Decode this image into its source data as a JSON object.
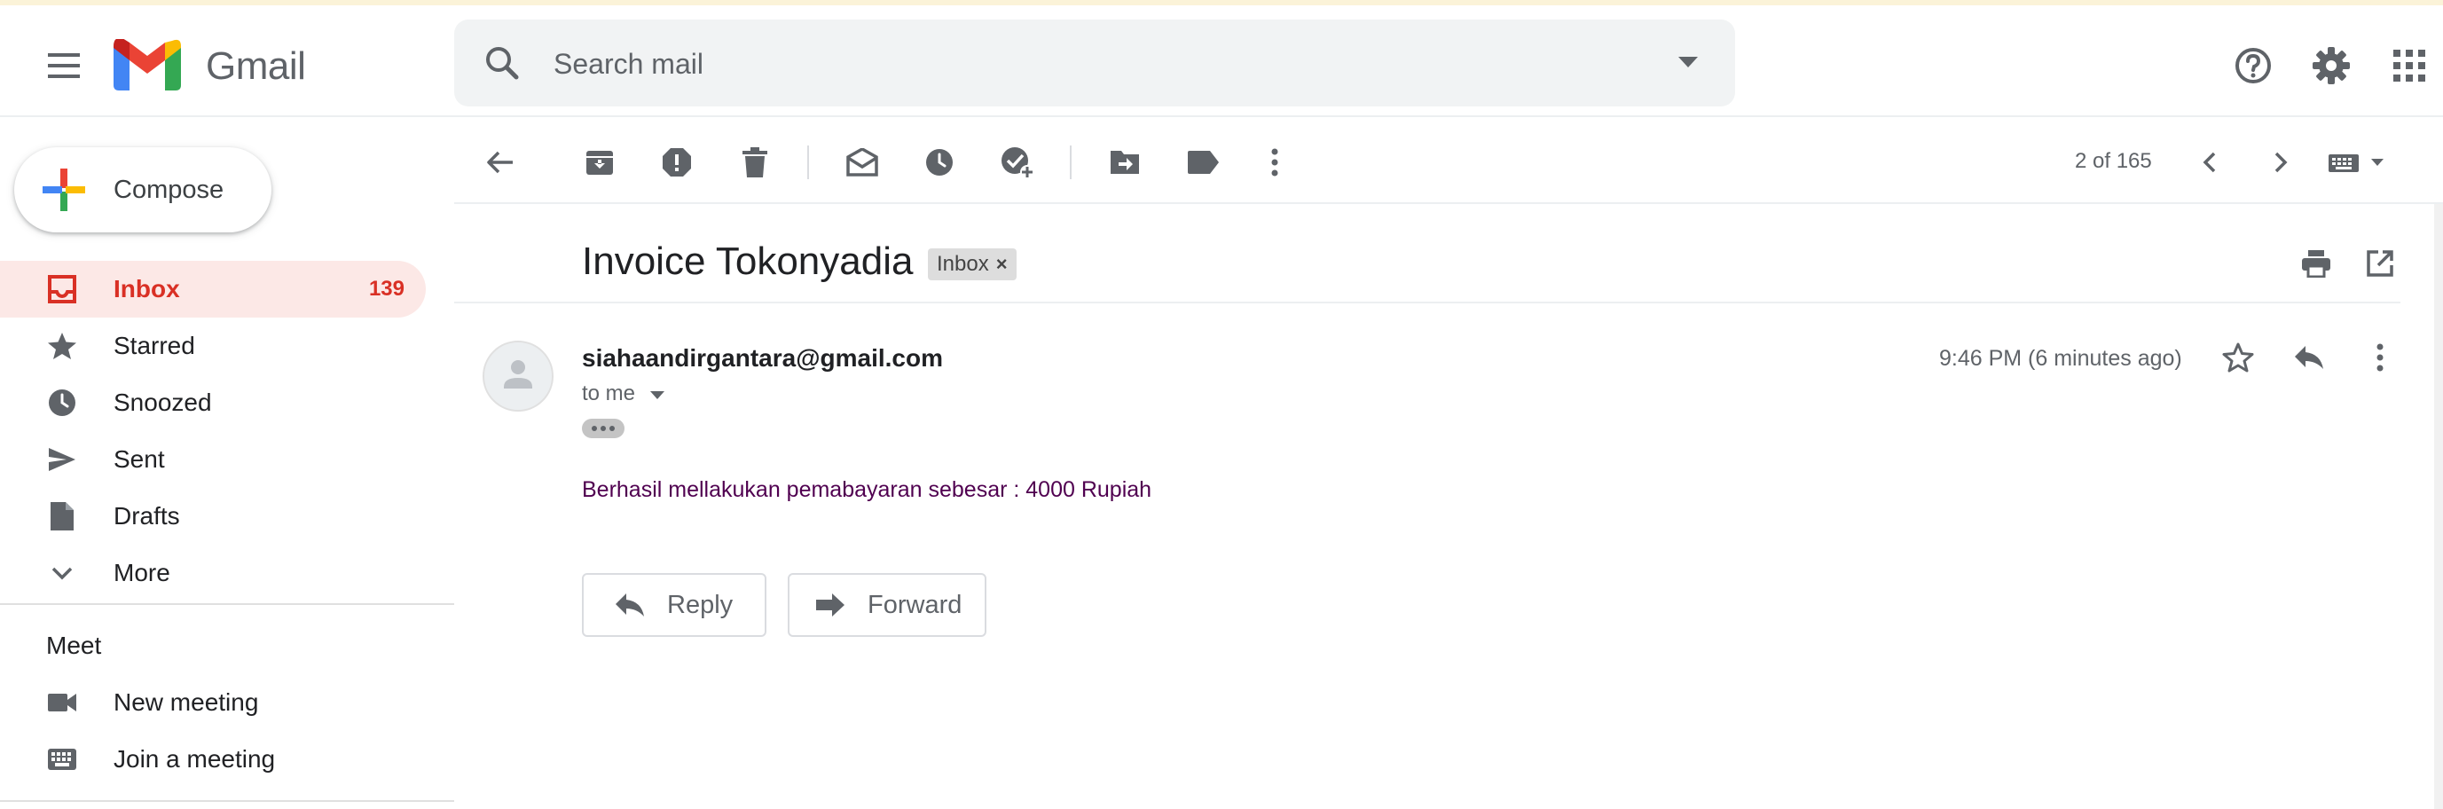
{
  "app": {
    "name": "Gmail"
  },
  "search": {
    "placeholder": "Search mail"
  },
  "compose": {
    "label": "Compose"
  },
  "sidebar": {
    "items": [
      {
        "label": "Inbox",
        "count": "139",
        "icon": "inbox-icon",
        "active": true
      },
      {
        "label": "Starred",
        "icon": "star-icon"
      },
      {
        "label": "Snoozed",
        "icon": "clock-icon"
      },
      {
        "label": "Sent",
        "icon": "send-icon"
      },
      {
        "label": "Drafts",
        "icon": "draft-icon"
      },
      {
        "label": "More",
        "icon": "chevron-down-icon"
      }
    ],
    "meet": {
      "title": "Meet",
      "items": [
        {
          "label": "New meeting",
          "icon": "video-icon"
        },
        {
          "label": "Join a meeting",
          "icon": "keyboard-icon"
        }
      ]
    }
  },
  "toolbar": {
    "pager": "2 of 165"
  },
  "message": {
    "subject": "Invoice Tokonyadia",
    "label": "Inbox",
    "label_remove": "×",
    "sender": "siahaandirgantara@gmail.com",
    "to": "to me",
    "time": "9:46 PM (6 minutes ago)",
    "body": "Berhasil mellakukan pemabayaran sebesar : 4000 Rupiah"
  },
  "actions": {
    "reply": "Reply",
    "forward": "Forward"
  },
  "colors": {
    "accent_red": "#d93025",
    "active_bg": "#fce8e6",
    "icon_gray": "#5f6368",
    "body_text": "#500050"
  }
}
